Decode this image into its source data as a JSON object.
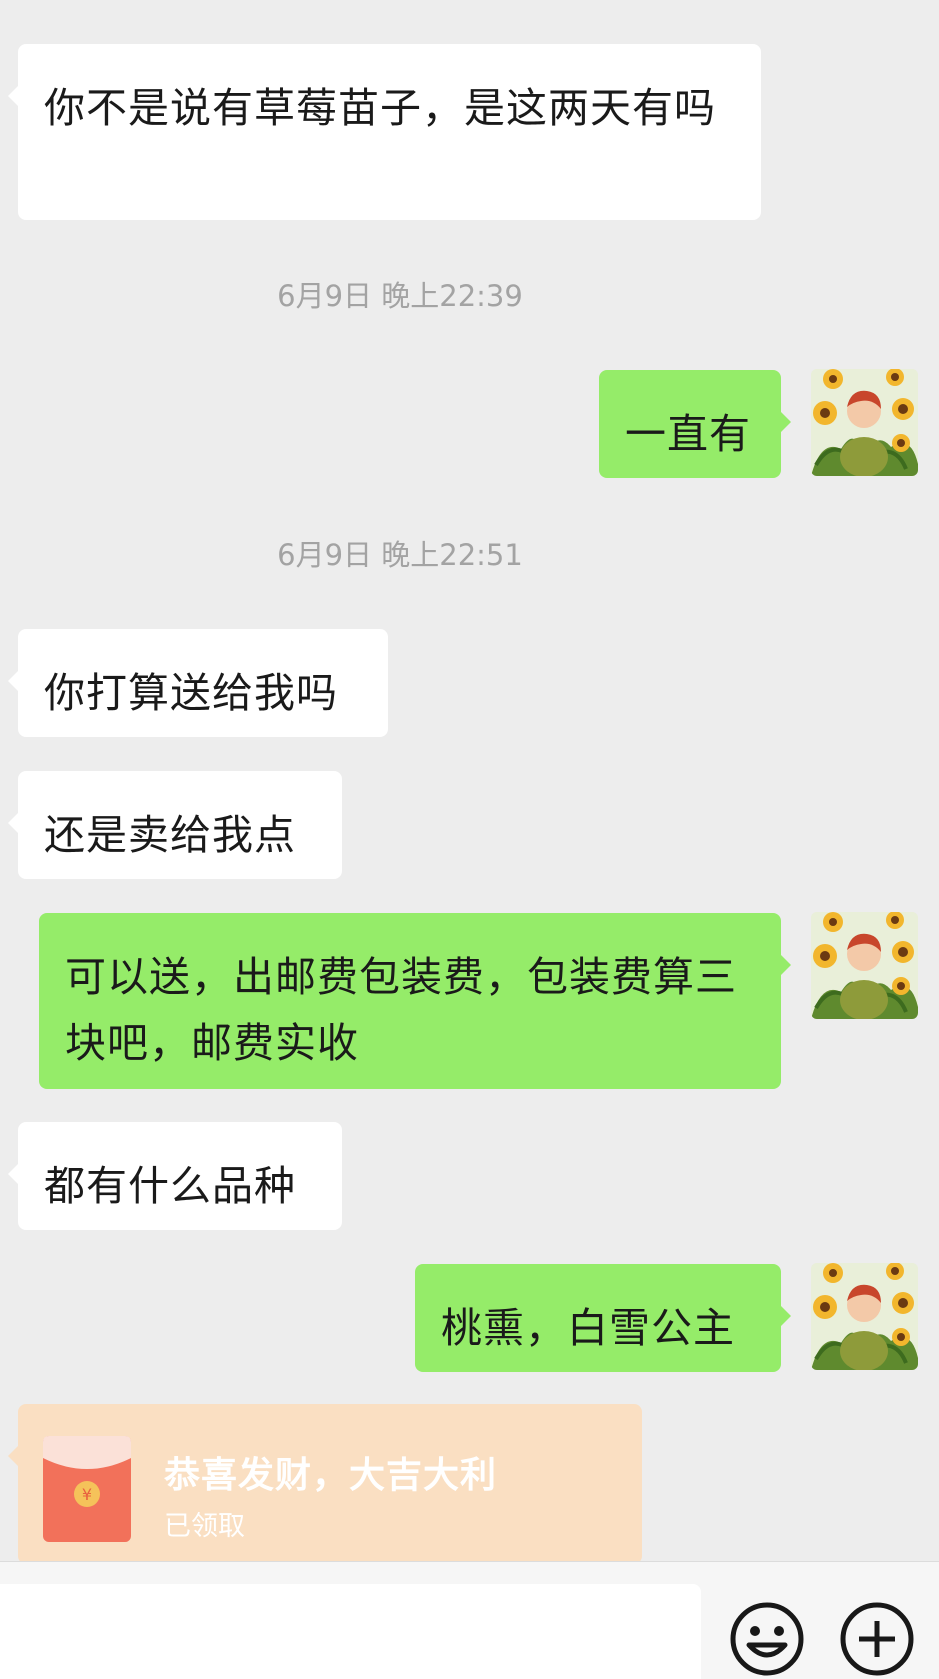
{
  "messages": [
    {
      "side": "in",
      "text": "你不是说有草莓苗子，是这两天有吗"
    },
    {
      "side": "out",
      "text": "一直有"
    },
    {
      "side": "in",
      "text": "你打算送给我吗"
    },
    {
      "side": "in",
      "text": "还是卖给我点"
    },
    {
      "side": "out",
      "text": "可以送，出邮费包装费，包装费算三块吧，邮费实收"
    },
    {
      "side": "in",
      "text": "都有什么品种"
    },
    {
      "side": "out",
      "text": "桃熏，白雪公主"
    }
  ],
  "timestamps": [
    "6月9日 晚上22:39",
    "6月9日 晚上22:51"
  ],
  "red_packet": {
    "title": "恭喜发财，大吉大利",
    "status": "已领取",
    "symbol": "¥"
  },
  "avatar": {
    "icon": "sunflower-portrait-icon"
  },
  "input_bar": {
    "placeholder": "",
    "emoji_icon": "smiley-icon",
    "more_icon": "plus-circle-icon"
  },
  "colors": {
    "background": "#ededed",
    "incoming_bubble": "#ffffff",
    "outgoing_bubble": "#95ec69",
    "red_packet": "#fadfc2",
    "timestamp_text": "#a3a3a3"
  }
}
